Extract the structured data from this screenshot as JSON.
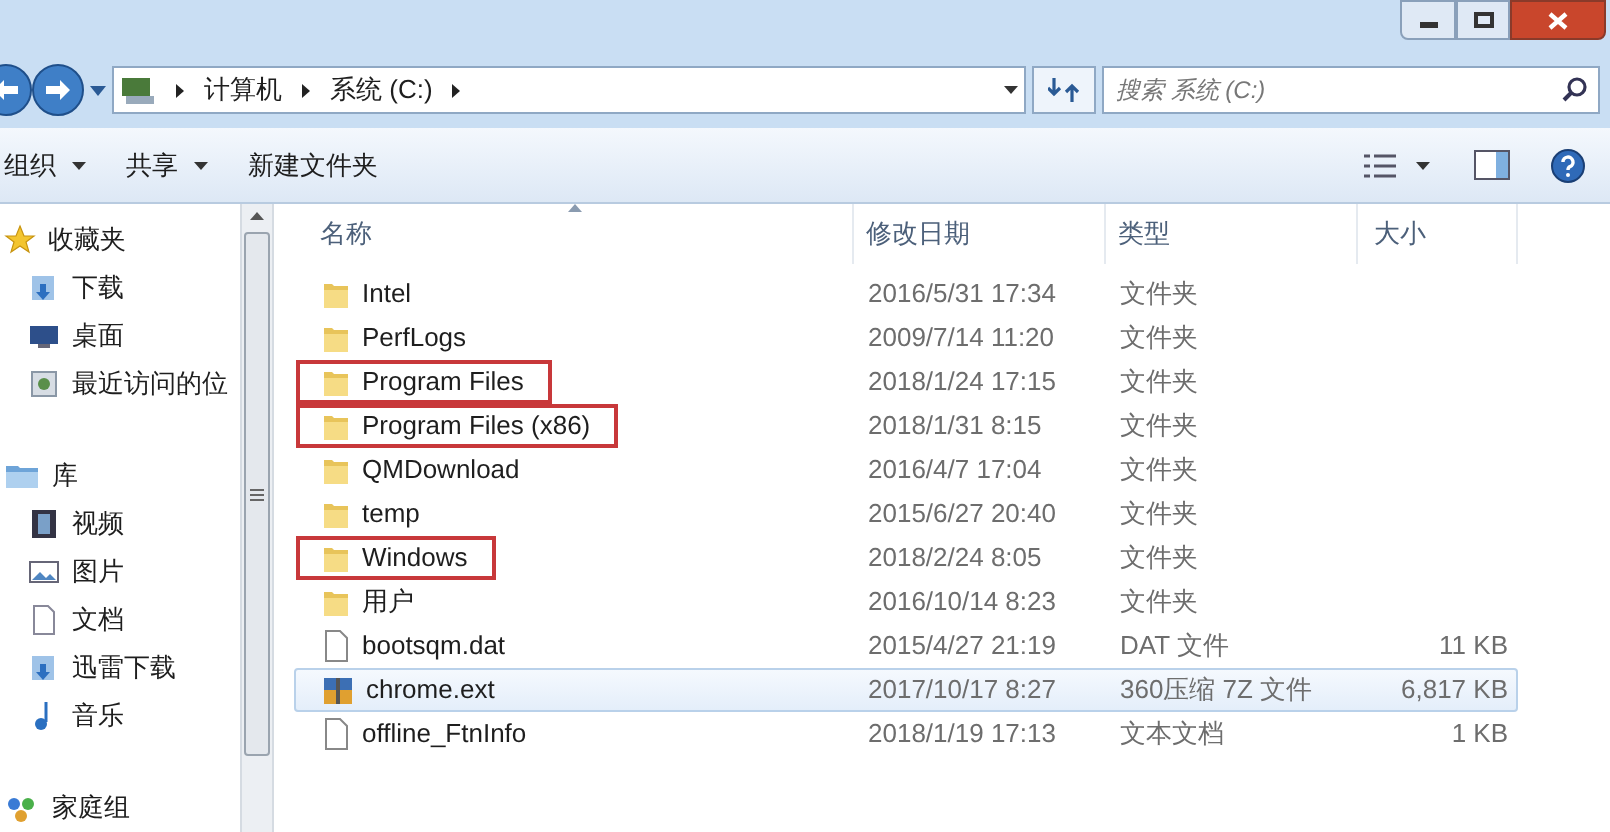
{
  "address_bar": {
    "path": [
      "计算机",
      "系统 (C:)"
    ]
  },
  "search": {
    "placeholder": "搜索 系统 (C:)"
  },
  "toolbar": {
    "buttons": [
      {
        "label": "组织",
        "dropdown": true
      },
      {
        "label": "共享",
        "dropdown": true
      },
      {
        "label": "新建文件夹",
        "dropdown": false
      }
    ]
  },
  "sidebar": {
    "groups": [
      {
        "label": "收藏夹",
        "kind": "favorites",
        "children": [
          {
            "label": "下载",
            "kind": "download"
          },
          {
            "label": "桌面",
            "kind": "desktop"
          },
          {
            "label": "最近访问的位",
            "kind": "recent"
          }
        ]
      },
      {
        "label": "库",
        "kind": "library",
        "children": [
          {
            "label": "视频",
            "kind": "video"
          },
          {
            "label": "图片",
            "kind": "picture"
          },
          {
            "label": "文档",
            "kind": "document"
          },
          {
            "label": "迅雷下载",
            "kind": "download2"
          },
          {
            "label": "音乐",
            "kind": "music"
          }
        ]
      },
      {
        "label": "家庭组",
        "kind": "homegroup"
      }
    ]
  },
  "table": {
    "columns": [
      "名称",
      "修改日期",
      "类型",
      "大小"
    ],
    "rows": [
      {
        "name": "Intel",
        "date": "2016/5/31 17:34",
        "type": "文件夹",
        "kind": "folder",
        "hovered": false,
        "marked": false
      },
      {
        "name": "PerfLogs",
        "date": "2009/7/14 11:20",
        "type": "文件夹",
        "kind": "folder",
        "hovered": false,
        "marked": false
      },
      {
        "name": "Program Files",
        "date": "2018/1/24 17:15",
        "type": "文件夹",
        "kind": "folder",
        "hovered": false,
        "marked": true
      },
      {
        "name": "Program Files (x86)",
        "date": "2018/1/31 8:15",
        "type": "文件夹",
        "kind": "folder",
        "hovered": false,
        "marked": true
      },
      {
        "name": "QMDownload",
        "date": "2016/4/7 17:04",
        "type": "文件夹",
        "kind": "folder",
        "hovered": false,
        "marked": false
      },
      {
        "name": "temp",
        "date": "2015/6/27 20:40",
        "type": "文件夹",
        "kind": "folder",
        "hovered": false,
        "marked": false
      },
      {
        "name": "Windows",
        "date": "2018/2/24 8:05",
        "type": "文件夹",
        "kind": "folder",
        "hovered": false,
        "marked": true
      },
      {
        "name": "用户",
        "date": "2016/10/14 8:23",
        "type": "文件夹",
        "kind": "folder",
        "hovered": false,
        "marked": false
      },
      {
        "name": "bootsqm.dat",
        "date": "2015/4/27 21:19",
        "type": "DAT 文件",
        "size": "11 KB",
        "kind": "file",
        "hovered": false,
        "marked": false
      },
      {
        "name": "chrome.ext",
        "date": "2017/10/17 8:27",
        "type": "360压缩 7Z 文件",
        "size": "6,817 KB",
        "kind": "archive",
        "hovered": true,
        "marked": false
      },
      {
        "name": "offline_FtnInfo",
        "date": "2018/1/19 17:13",
        "type": "文本文档",
        "size": "1 KB",
        "kind": "file",
        "hovered": false,
        "marked": false
      }
    ]
  }
}
